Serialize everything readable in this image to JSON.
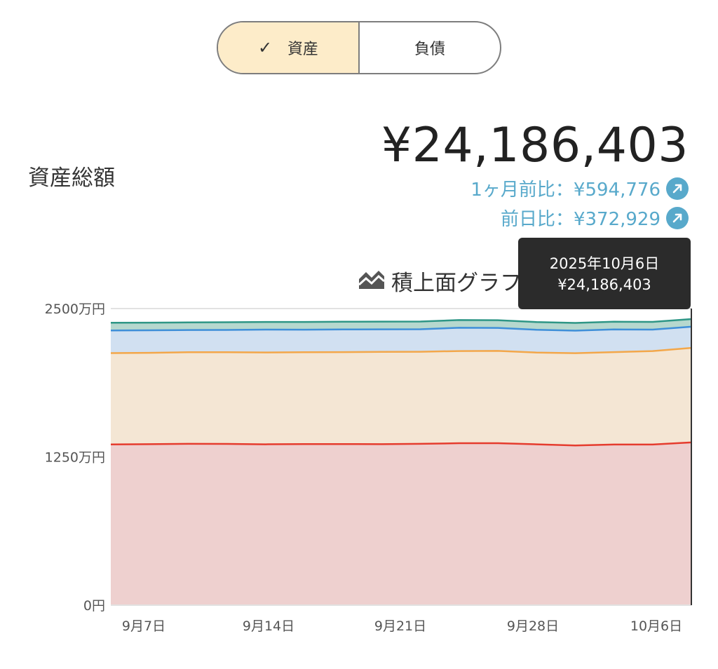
{
  "toggle": {
    "asset_label": "資産",
    "liability_label": "負債"
  },
  "summary": {
    "label": "資産総額",
    "total": "¥24,186,403",
    "month_change": "1ヶ月前比：¥594,776",
    "day_change": "前日比：¥372,929"
  },
  "chart_title": "積上面グラフ",
  "tooltip": {
    "date": "2025年10月6日",
    "value": "¥24,186,403"
  },
  "colors": {
    "accent": "#58a9cb",
    "toggle_active": "#fdecc9"
  },
  "chart_data": {
    "type": "area",
    "stacked": true,
    "x": [
      "9月7日",
      "9月9日",
      "9月11日",
      "9月13日",
      "9月15日",
      "9月17日",
      "9月19日",
      "9月21日",
      "9月23日",
      "9月25日",
      "9月27日",
      "9月29日",
      "10月1日",
      "10月3日",
      "10月5日",
      "10月6日"
    ],
    "xticks": [
      "9月7日",
      "9月14日",
      "9月21日",
      "9月28日",
      "10月6日"
    ],
    "yticks": [
      "0円",
      "1250万円",
      "2500万円"
    ],
    "ylim": [
      0,
      25000000
    ],
    "series": [
      {
        "color": "#e53c2e",
        "fill": "#eed0cf",
        "values": [
          13550000,
          13570000,
          13600000,
          13590000,
          13560000,
          13580000,
          13580000,
          13570000,
          13600000,
          13650000,
          13650000,
          13560000,
          13460000,
          13540000,
          13540000,
          13720000
        ]
      },
      {
        "color": "#f3a74a",
        "fill": "#f4e6d4",
        "values": [
          7700000,
          7700000,
          7720000,
          7730000,
          7740000,
          7740000,
          7750000,
          7780000,
          7760000,
          7770000,
          7780000,
          7730000,
          7780000,
          7790000,
          7880000,
          7960000
        ]
      },
      {
        "color": "#3f8fd8",
        "fill": "#d1e0f1",
        "values": [
          1900000,
          1900000,
          1870000,
          1880000,
          1930000,
          1900000,
          1910000,
          1900000,
          1900000,
          1960000,
          1940000,
          1920000,
          1900000,
          1910000,
          1810000,
          1790000
        ]
      },
      {
        "color": "#2e9686",
        "fill": "#b6d8ce",
        "values": [
          650000,
          640000,
          640000,
          650000,
          640000,
          650000,
          650000,
          650000,
          650000,
          650000,
          650000,
          650000,
          650000,
          650000,
          650000,
          640000
        ]
      }
    ]
  }
}
